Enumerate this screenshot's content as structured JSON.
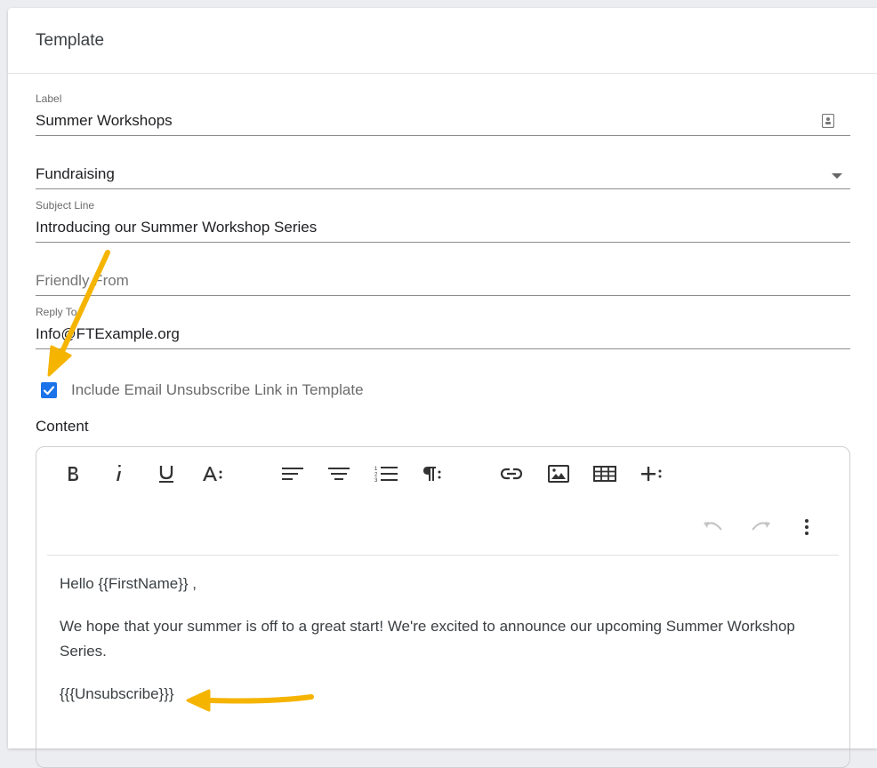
{
  "card": {
    "title": "Template"
  },
  "fields": {
    "label": {
      "label": "Label",
      "value": "Summer Workshops"
    },
    "category": {
      "value": "Fundraising"
    },
    "subject": {
      "label": "Subject Line",
      "value": "Introducing our Summer Workshop Series"
    },
    "friendly_from": {
      "placeholder": "Friendly From"
    },
    "reply_to": {
      "label": "Reply To",
      "value": "Info@FTExample.org"
    }
  },
  "unsubscribe_checkbox": {
    "label": "Include Email Unsubscribe Link in Template",
    "checked": true
  },
  "content": {
    "label": "Content",
    "toolbar": [
      "bold",
      "italic",
      "underline",
      "text-style",
      "align-left",
      "align-center",
      "numbered-list",
      "paragraph-format",
      "link",
      "image",
      "table",
      "insert-more",
      "undo",
      "redo",
      "more-options"
    ],
    "body": {
      "greeting": "Hello {{FirstName}} ,",
      "paragraph": "We hope that your summer is off to a great start! We're excited to announce our upcoming Summer Workshop Series.",
      "unsubscribe_token": "{{{Unsubscribe}}}"
    }
  },
  "colors": {
    "accent": "#1a73e8",
    "annotation_arrow": "#f5b400"
  }
}
